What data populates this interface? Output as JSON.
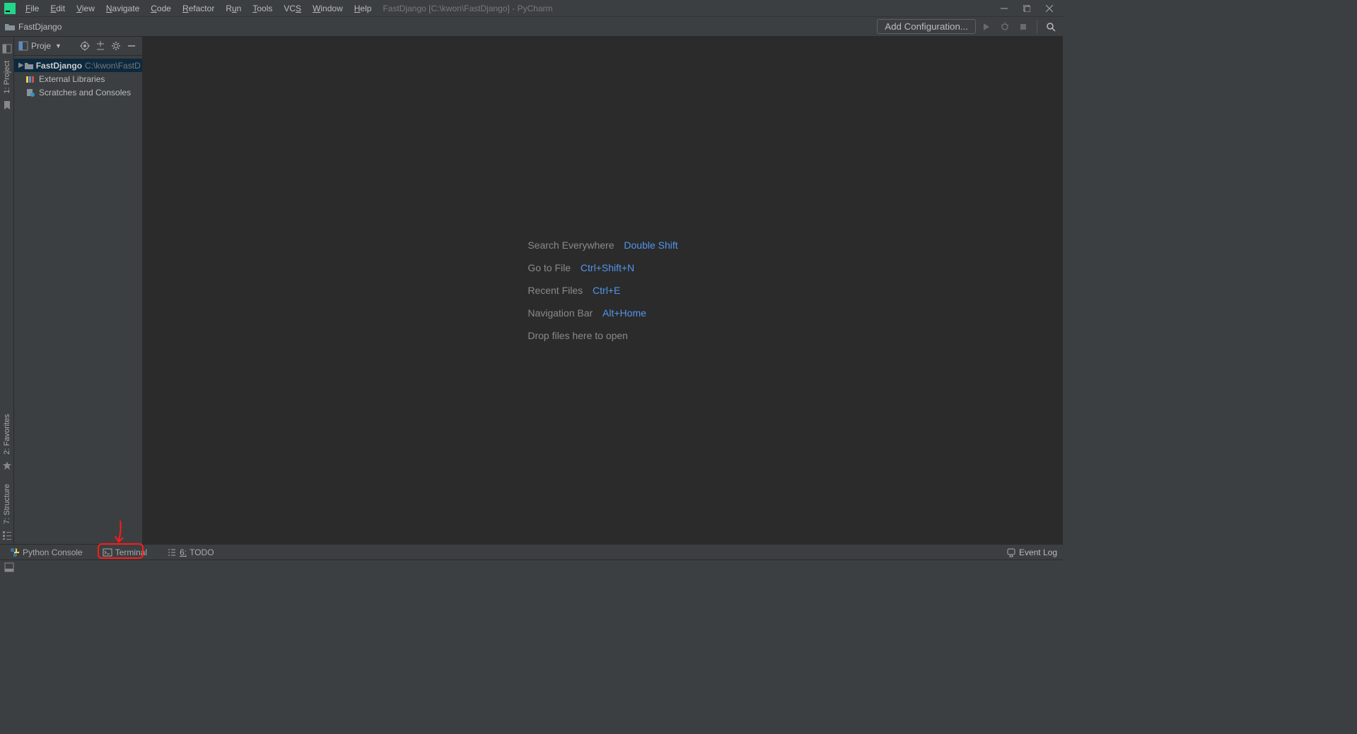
{
  "menu": {
    "items": [
      "File",
      "Edit",
      "View",
      "Navigate",
      "Code",
      "Refactor",
      "Run",
      "Tools",
      "VCS",
      "Window",
      "Help"
    ],
    "title": "FastDjango [C:\\kwon\\FastDjango] - PyCharm"
  },
  "toolbar": {
    "breadcrumb": "FastDjango",
    "config_button": "Add Configuration..."
  },
  "project_panel": {
    "title": "Proje",
    "tree": {
      "root_name": "FastDjango",
      "root_path": "C:\\kwon\\FastD",
      "external": "External Libraries",
      "scratches": "Scratches and Consoles"
    }
  },
  "gutter": {
    "project": "1: Project",
    "favorites": "2: Favorites",
    "structure": "7: Structure"
  },
  "welcome": {
    "search_label": "Search Everywhere",
    "search_key": "Double Shift",
    "goto_label": "Go to File",
    "goto_key": "Ctrl+Shift+N",
    "recent_label": "Recent Files",
    "recent_key": "Ctrl+E",
    "nav_label": "Navigation Bar",
    "nav_key": "Alt+Home",
    "drop": "Drop files here to open"
  },
  "bottom": {
    "python_console": "Python Console",
    "terminal": "Terminal",
    "todo_num": "6:",
    "todo": "TODO",
    "event_log": "Event Log"
  }
}
